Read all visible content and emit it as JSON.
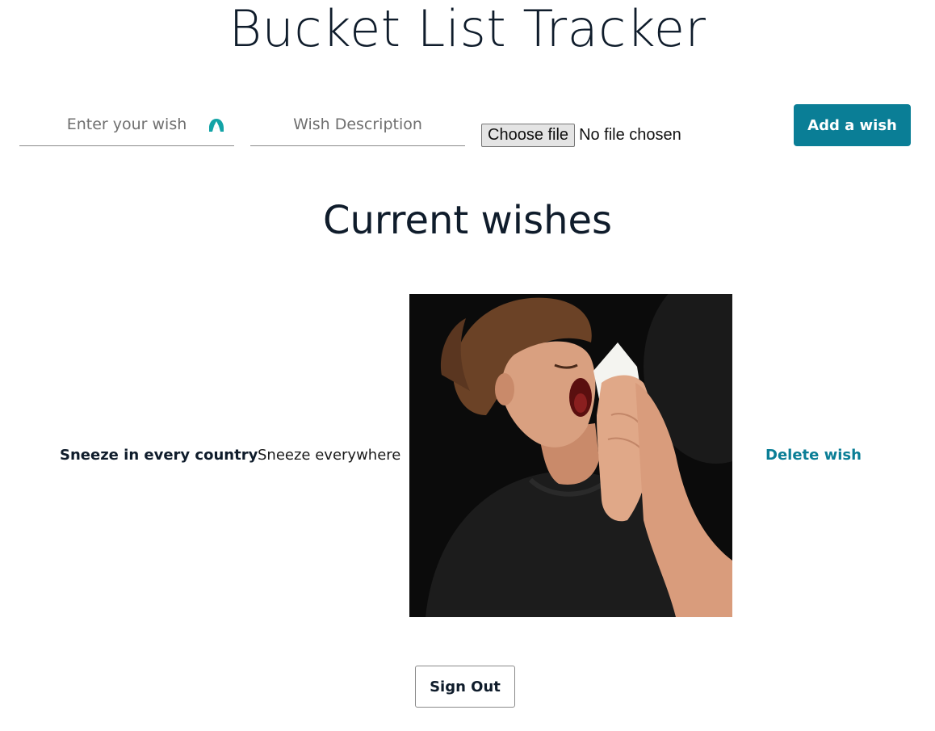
{
  "app": {
    "title": "Bucket List Tracker"
  },
  "form": {
    "wish_placeholder": "Enter your wish",
    "description_placeholder": "Wish Description",
    "file_button_label": "Choose file",
    "file_status": "No file chosen",
    "add_button_label": "Add a wish"
  },
  "wishes": {
    "heading": "Current wishes",
    "items": [
      {
        "name": "Sneeze in every country",
        "description": "Sneeze everywhere",
        "delete_label": "Delete wish"
      }
    ]
  },
  "footer": {
    "signout_label": "Sign Out"
  },
  "colors": {
    "accent": "#0a7e96",
    "text": "#0f1c2b"
  },
  "icons": {
    "field_extension": "password-manager-icon"
  }
}
